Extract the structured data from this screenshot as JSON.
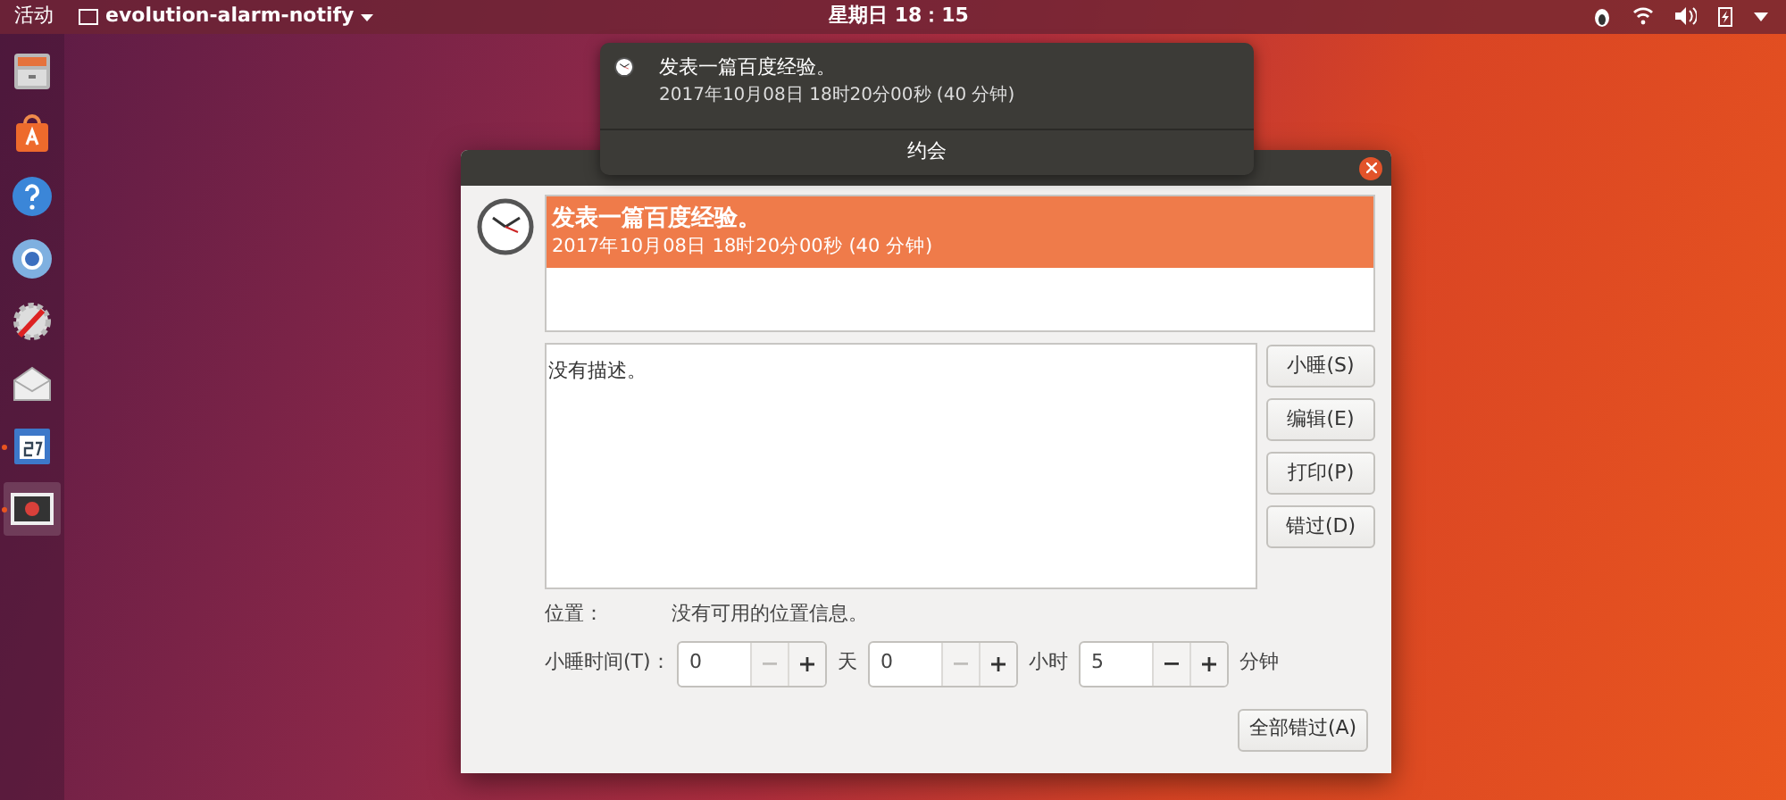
{
  "top_bar": {
    "activities": "活动",
    "app_menu": "evolution-alarm-notify",
    "clock": "星期日 18：15"
  },
  "dock": {
    "items": [
      {
        "kind": "files",
        "running": false,
        "selected": false
      },
      {
        "kind": "store",
        "running": false,
        "selected": false
      },
      {
        "kind": "help",
        "running": false,
        "selected": false
      },
      {
        "kind": "browser",
        "running": false,
        "selected": false
      },
      {
        "kind": "tools",
        "running": false,
        "selected": false
      },
      {
        "kind": "mail",
        "running": false,
        "selected": false
      },
      {
        "kind": "calendar",
        "running": true,
        "selected": false
      },
      {
        "kind": "alarm",
        "running": true,
        "selected": true
      }
    ]
  },
  "notification": {
    "title": "发表一篇百度经验。",
    "time": "2017年10月08日 18时20分00秒 (40 分钟)",
    "action": "约会"
  },
  "dialog": {
    "alarms": [
      {
        "title": "发表一篇百度经验。",
        "time": "2017年10月08日 18时20分00秒 (40 分钟)",
        "selected": true
      }
    ],
    "description": "没有描述。",
    "buttons": [
      "小睡(S)",
      "编辑(E)",
      "打印(P)",
      "错过(D)"
    ],
    "location_label": "位置：",
    "location_value": "没有可用的位置信息。",
    "snooze_label": "小睡时间(T)：",
    "snooze": [
      {
        "value": "0",
        "unit": "天",
        "minus_disabled": true
      },
      {
        "value": "0",
        "unit": "小时",
        "minus_disabled": true
      },
      {
        "value": "5",
        "unit": "分钟",
        "minus_disabled": false
      }
    ],
    "dismiss_all": "全部错过(A)"
  }
}
